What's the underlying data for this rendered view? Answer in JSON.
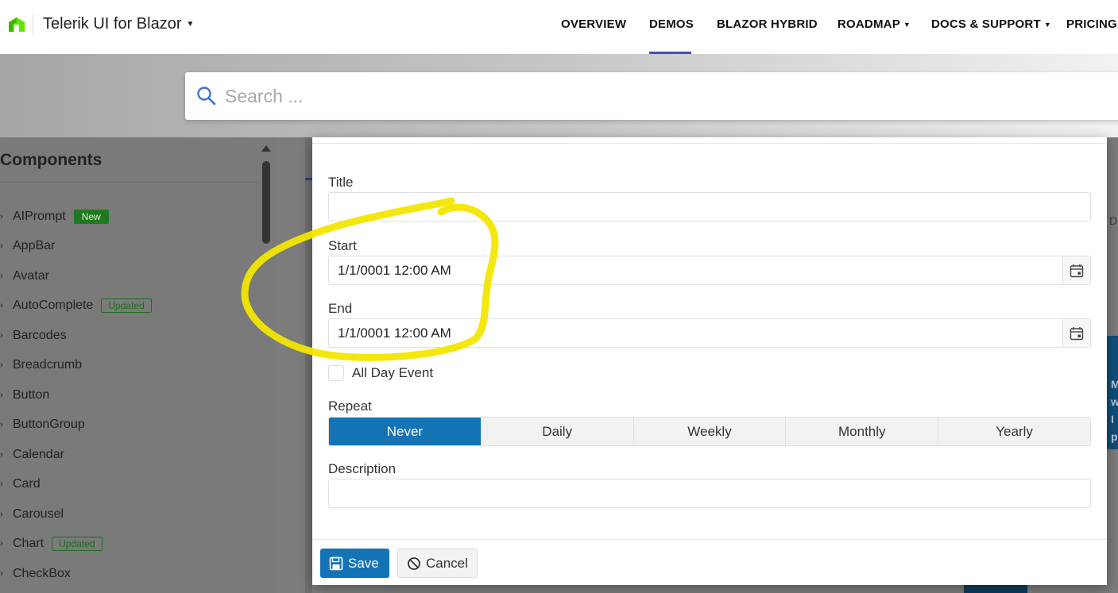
{
  "header": {
    "brand": "Telerik UI for Blazor",
    "nav": [
      {
        "label": "OVERVIEW",
        "has_caret": false
      },
      {
        "label": "DEMOS",
        "has_caret": false,
        "active": true
      },
      {
        "label": "BLAZOR HYBRID",
        "has_caret": false
      },
      {
        "label": "ROADMAP",
        "has_caret": true
      },
      {
        "label": "DOCS & SUPPORT",
        "has_caret": true
      },
      {
        "label": "PRICING",
        "has_caret": false
      }
    ]
  },
  "search": {
    "placeholder": "Search ..."
  },
  "sidebar": {
    "title": "Components",
    "items": [
      {
        "label": "AIPrompt",
        "badge": "New"
      },
      {
        "label": "AppBar",
        "badge": ""
      },
      {
        "label": "Avatar",
        "badge": ""
      },
      {
        "label": "AutoComplete",
        "badge": "Updated"
      },
      {
        "label": "Barcodes",
        "badge": ""
      },
      {
        "label": "Breadcrumb",
        "badge": ""
      },
      {
        "label": "Button",
        "badge": ""
      },
      {
        "label": "ButtonGroup",
        "badge": ""
      },
      {
        "label": "Calendar",
        "badge": ""
      },
      {
        "label": "Card",
        "badge": ""
      },
      {
        "label": "Carousel",
        "badge": ""
      },
      {
        "label": "Chart",
        "badge": "Updated"
      },
      {
        "label": "CheckBox",
        "badge": ""
      }
    ]
  },
  "dialog": {
    "title_label": "Title",
    "title_value": "",
    "start_label": "Start",
    "start_value": "1/1/0001 12:00 AM",
    "end_label": "End",
    "end_value": "1/1/0001 12:00 AM",
    "all_day_label": "All Day Event",
    "all_day_checked": false,
    "repeat_label": "Repeat",
    "repeat_options": [
      "Never",
      "Daily",
      "Weekly",
      "Monthly",
      "Yearly"
    ],
    "repeat_selected": "Never",
    "description_label": "Description",
    "description_value": "",
    "save_label": "Save",
    "cancel_label": "Cancel"
  },
  "background": {
    "edge_letters": [
      "M",
      "w",
      "I",
      "p"
    ],
    "edge_small": "D"
  },
  "colors": {
    "accent": "#1473b5",
    "nav_underline": "#3f51b5",
    "badge_new": "#1f7a1f",
    "annotation": "#f2e600",
    "brand_green": "#5ce500"
  },
  "icons": {
    "logo": "telerik-logo-icon",
    "search": "search-icon",
    "calendar": "calendar-icon",
    "save": "save-icon",
    "cancel": "cancel-icon",
    "chevron": "chevron-right-icon"
  }
}
